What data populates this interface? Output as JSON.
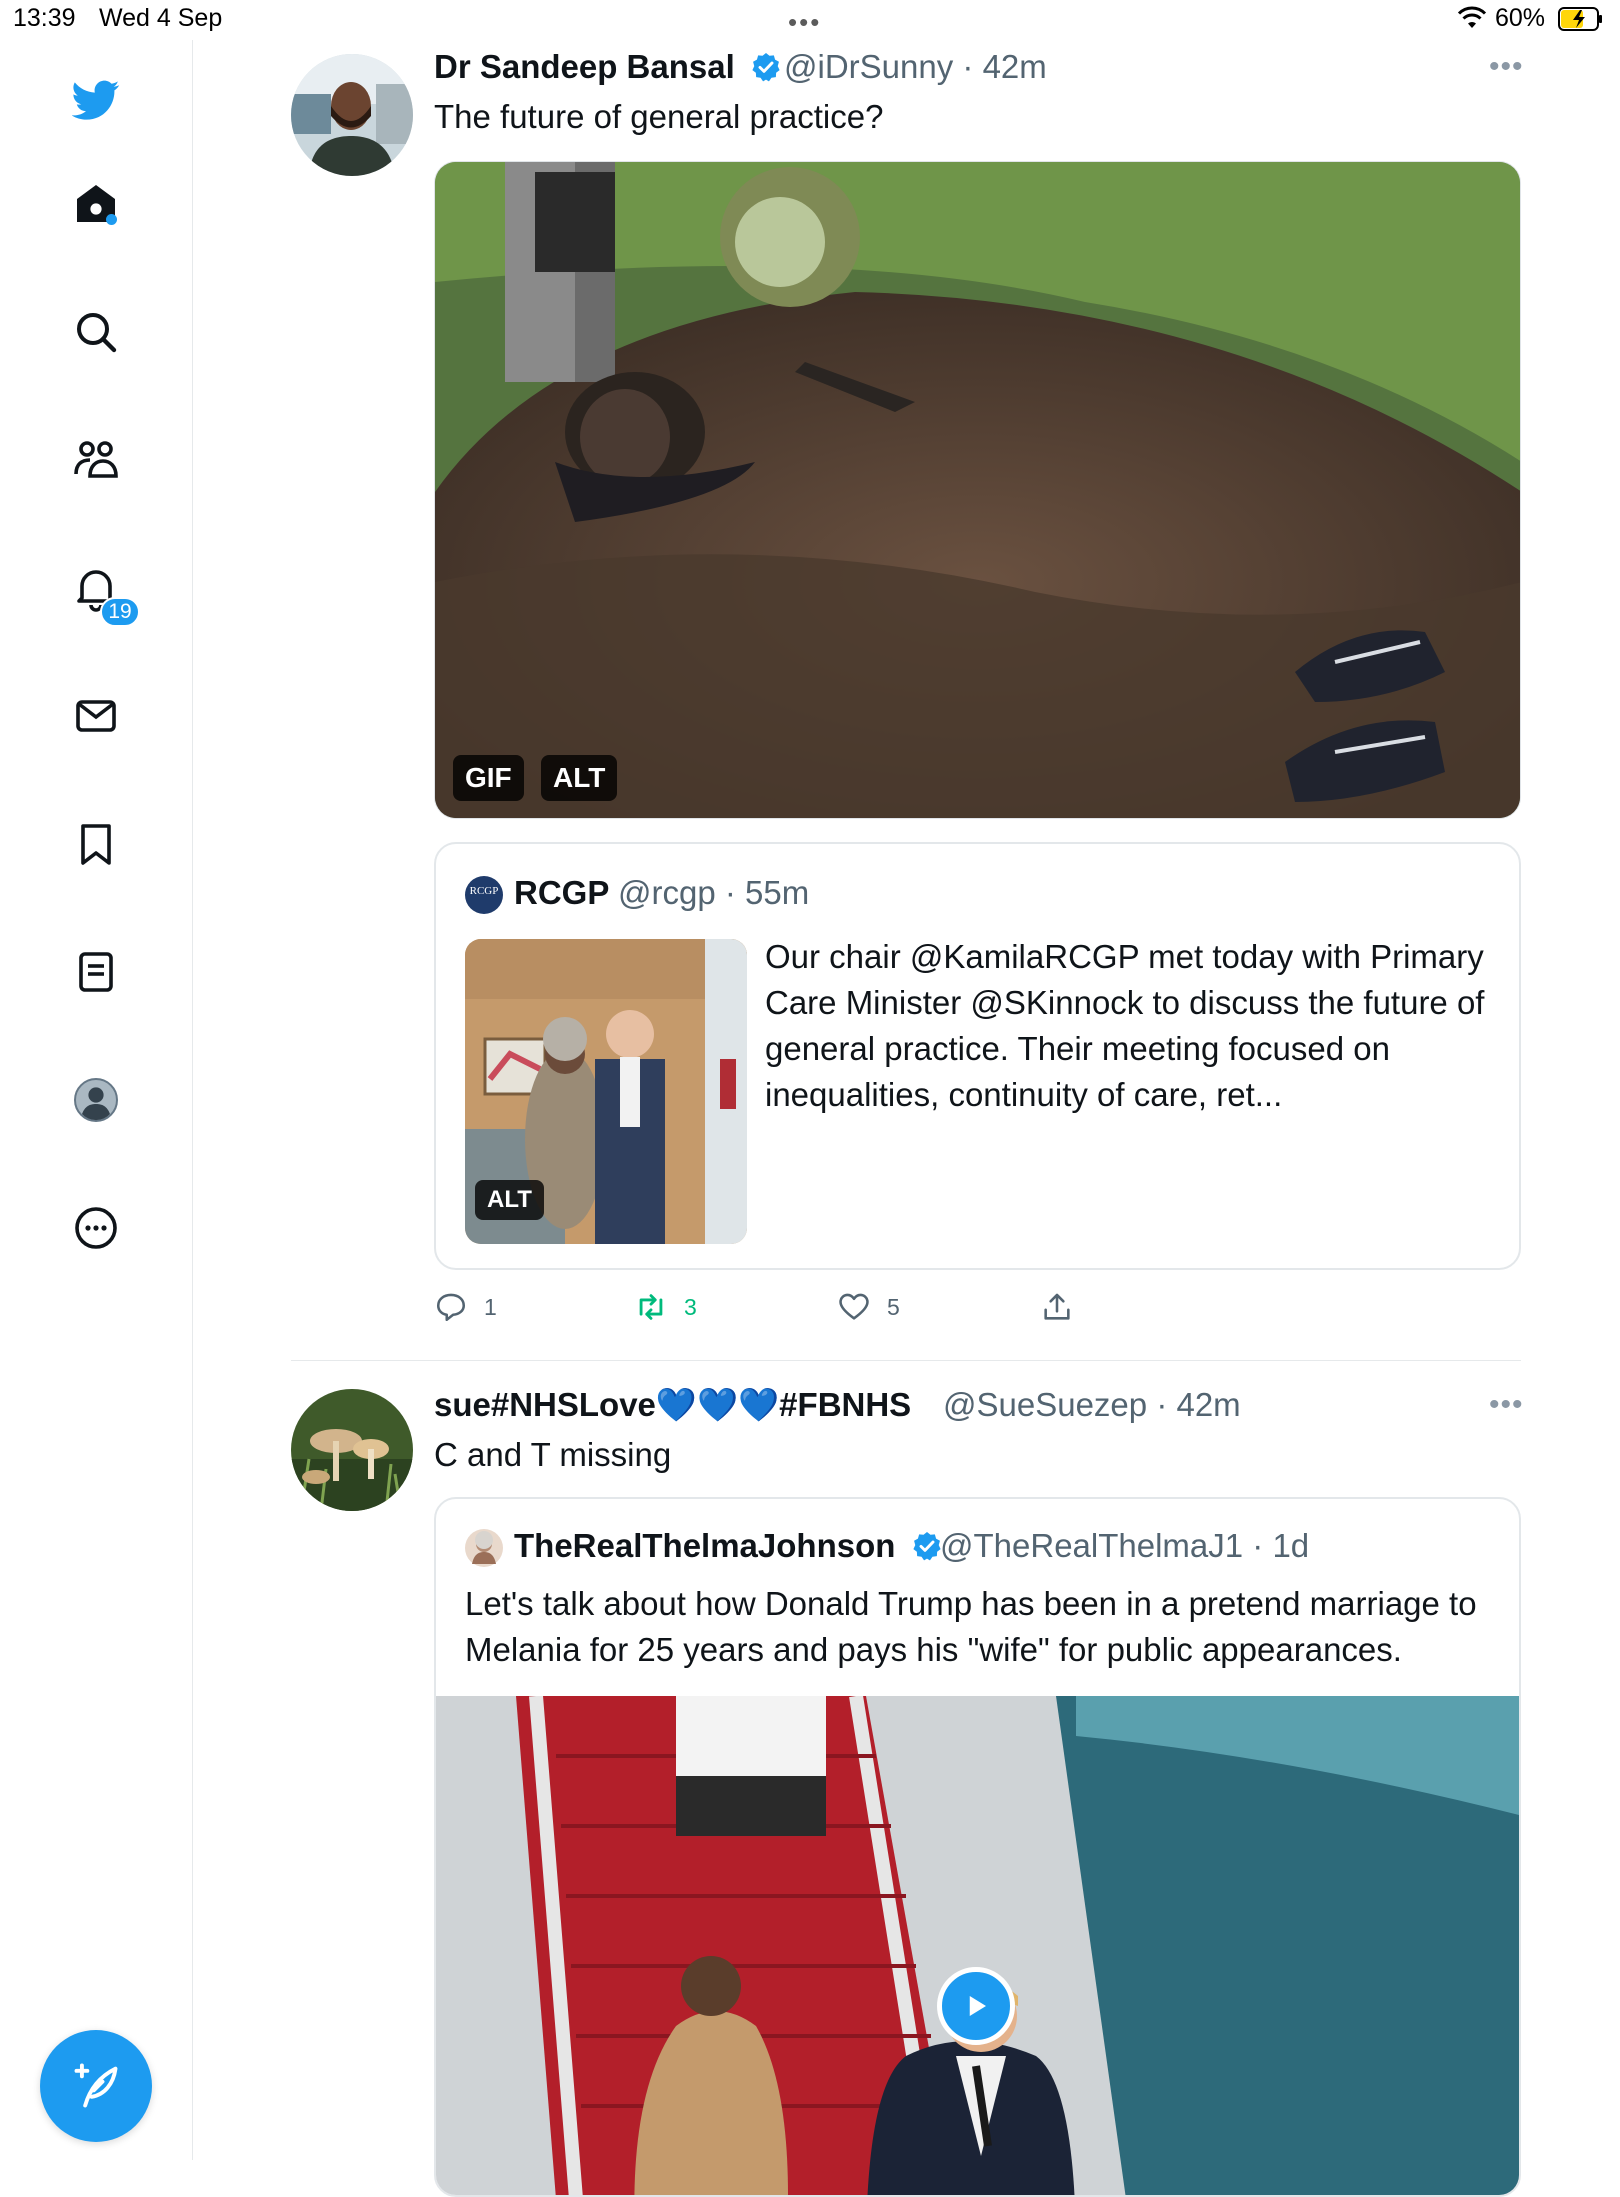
{
  "status_bar": {
    "time": "13:39",
    "date": "Wed 4 Sep",
    "battery": "60%"
  },
  "sidebar": {
    "items": [
      {
        "icon": "twitter-logo-icon"
      },
      {
        "icon": "home-icon"
      },
      {
        "icon": "search-icon"
      },
      {
        "icon": "communities-icon"
      },
      {
        "icon": "notifications-icon"
      },
      {
        "icon": "messages-icon"
      },
      {
        "icon": "bookmarks-icon"
      },
      {
        "icon": "lists-icon"
      },
      {
        "icon": "profile-icon"
      },
      {
        "icon": "more-icon"
      }
    ],
    "notifications_badge": "19",
    "compose_icon": "compose-tweet-icon"
  },
  "tweets": [
    {
      "author_name": "Dr Sandeep Bansal",
      "handle": "@iDrSunny",
      "time": "· 42m",
      "text": "The future of general practice?",
      "media_badges": {
        "gif": "GIF",
        "alt": "ALT"
      },
      "quote": {
        "author_name": "RCGP",
        "avatar_text": "RCGP",
        "handle": "@rcgp",
        "time": "· 55m",
        "text": "Our chair @KamilaRCGP met today with Primary Care Minister @SKinnock to discuss the future of general practice. Their meeting focused on inequalities, continuity of care, ret...",
        "image_badge": "ALT"
      },
      "actions": {
        "replies": "1",
        "retweets": "3",
        "likes": "5"
      }
    },
    {
      "author_name": "sue#NHSLove💙💙💙#FBNHS",
      "handle": "@SueSuezep",
      "time": "· 42m",
      "text": "C and T missing",
      "quote": {
        "author_name": "TheRealThelmaJohnson",
        "handle": "@TheRealThelmaJ1",
        "time": "· 1d",
        "text": "Let's talk about how Donald Trump has been in a pretend marriage to Melania for 25 years and pays his \"wife\" for public appearances."
      }
    }
  ],
  "colors": {
    "accent": "#1d9bf0",
    "retweet_green": "#00ba7c"
  }
}
